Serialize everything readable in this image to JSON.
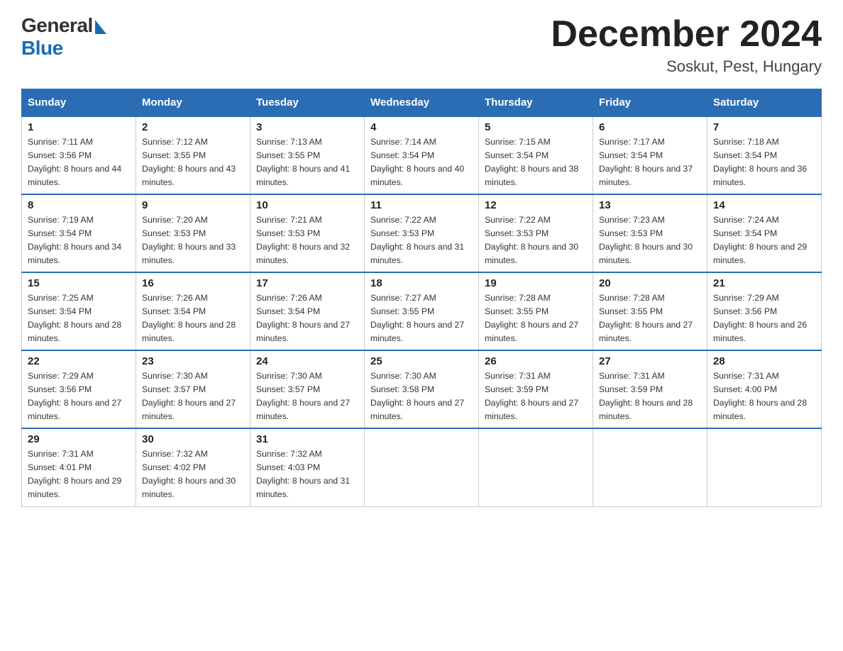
{
  "header": {
    "logo_general": "General",
    "logo_blue": "Blue",
    "title": "December 2024",
    "subtitle": "Soskut, Pest, Hungary"
  },
  "days_of_week": [
    "Sunday",
    "Monday",
    "Tuesday",
    "Wednesday",
    "Thursday",
    "Friday",
    "Saturday"
  ],
  "weeks": [
    [
      {
        "day": "1",
        "sunrise": "7:11 AM",
        "sunset": "3:56 PM",
        "daylight": "8 hours and 44 minutes."
      },
      {
        "day": "2",
        "sunrise": "7:12 AM",
        "sunset": "3:55 PM",
        "daylight": "8 hours and 43 minutes."
      },
      {
        "day": "3",
        "sunrise": "7:13 AM",
        "sunset": "3:55 PM",
        "daylight": "8 hours and 41 minutes."
      },
      {
        "day": "4",
        "sunrise": "7:14 AM",
        "sunset": "3:54 PM",
        "daylight": "8 hours and 40 minutes."
      },
      {
        "day": "5",
        "sunrise": "7:15 AM",
        "sunset": "3:54 PM",
        "daylight": "8 hours and 38 minutes."
      },
      {
        "day": "6",
        "sunrise": "7:17 AM",
        "sunset": "3:54 PM",
        "daylight": "8 hours and 37 minutes."
      },
      {
        "day": "7",
        "sunrise": "7:18 AM",
        "sunset": "3:54 PM",
        "daylight": "8 hours and 36 minutes."
      }
    ],
    [
      {
        "day": "8",
        "sunrise": "7:19 AM",
        "sunset": "3:54 PM",
        "daylight": "8 hours and 34 minutes."
      },
      {
        "day": "9",
        "sunrise": "7:20 AM",
        "sunset": "3:53 PM",
        "daylight": "8 hours and 33 minutes."
      },
      {
        "day": "10",
        "sunrise": "7:21 AM",
        "sunset": "3:53 PM",
        "daylight": "8 hours and 32 minutes."
      },
      {
        "day": "11",
        "sunrise": "7:22 AM",
        "sunset": "3:53 PM",
        "daylight": "8 hours and 31 minutes."
      },
      {
        "day": "12",
        "sunrise": "7:22 AM",
        "sunset": "3:53 PM",
        "daylight": "8 hours and 30 minutes."
      },
      {
        "day": "13",
        "sunrise": "7:23 AM",
        "sunset": "3:53 PM",
        "daylight": "8 hours and 30 minutes."
      },
      {
        "day": "14",
        "sunrise": "7:24 AM",
        "sunset": "3:54 PM",
        "daylight": "8 hours and 29 minutes."
      }
    ],
    [
      {
        "day": "15",
        "sunrise": "7:25 AM",
        "sunset": "3:54 PM",
        "daylight": "8 hours and 28 minutes."
      },
      {
        "day": "16",
        "sunrise": "7:26 AM",
        "sunset": "3:54 PM",
        "daylight": "8 hours and 28 minutes."
      },
      {
        "day": "17",
        "sunrise": "7:26 AM",
        "sunset": "3:54 PM",
        "daylight": "8 hours and 27 minutes."
      },
      {
        "day": "18",
        "sunrise": "7:27 AM",
        "sunset": "3:55 PM",
        "daylight": "8 hours and 27 minutes."
      },
      {
        "day": "19",
        "sunrise": "7:28 AM",
        "sunset": "3:55 PM",
        "daylight": "8 hours and 27 minutes."
      },
      {
        "day": "20",
        "sunrise": "7:28 AM",
        "sunset": "3:55 PM",
        "daylight": "8 hours and 27 minutes."
      },
      {
        "day": "21",
        "sunrise": "7:29 AM",
        "sunset": "3:56 PM",
        "daylight": "8 hours and 26 minutes."
      }
    ],
    [
      {
        "day": "22",
        "sunrise": "7:29 AM",
        "sunset": "3:56 PM",
        "daylight": "8 hours and 27 minutes."
      },
      {
        "day": "23",
        "sunrise": "7:30 AM",
        "sunset": "3:57 PM",
        "daylight": "8 hours and 27 minutes."
      },
      {
        "day": "24",
        "sunrise": "7:30 AM",
        "sunset": "3:57 PM",
        "daylight": "8 hours and 27 minutes."
      },
      {
        "day": "25",
        "sunrise": "7:30 AM",
        "sunset": "3:58 PM",
        "daylight": "8 hours and 27 minutes."
      },
      {
        "day": "26",
        "sunrise": "7:31 AM",
        "sunset": "3:59 PM",
        "daylight": "8 hours and 27 minutes."
      },
      {
        "day": "27",
        "sunrise": "7:31 AM",
        "sunset": "3:59 PM",
        "daylight": "8 hours and 28 minutes."
      },
      {
        "day": "28",
        "sunrise": "7:31 AM",
        "sunset": "4:00 PM",
        "daylight": "8 hours and 28 minutes."
      }
    ],
    [
      {
        "day": "29",
        "sunrise": "7:31 AM",
        "sunset": "4:01 PM",
        "daylight": "8 hours and 29 minutes."
      },
      {
        "day": "30",
        "sunrise": "7:32 AM",
        "sunset": "4:02 PM",
        "daylight": "8 hours and 30 minutes."
      },
      {
        "day": "31",
        "sunrise": "7:32 AM",
        "sunset": "4:03 PM",
        "daylight": "8 hours and 31 minutes."
      },
      null,
      null,
      null,
      null
    ]
  ],
  "labels": {
    "sunrise": "Sunrise: ",
    "sunset": "Sunset: ",
    "daylight": "Daylight: "
  }
}
